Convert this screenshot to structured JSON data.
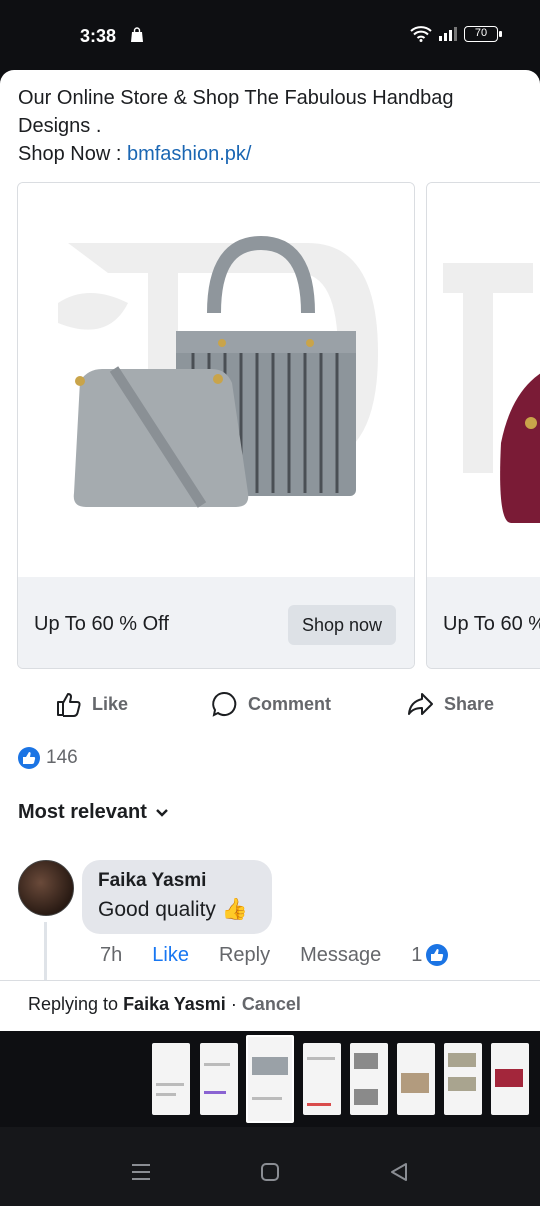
{
  "status": {
    "time": "3:38",
    "battery": "70"
  },
  "post": {
    "line1": "Our Online Store & Shop The Fabulous Handbag Designs .",
    "shop_prefix": "Shop Now : ",
    "link": "bmfashion.pk/"
  },
  "carousel": [
    {
      "title": "Up To 60 % Off",
      "button": "Shop now"
    },
    {
      "title": "Up To 60 %"
    }
  ],
  "actions": {
    "like": "Like",
    "comment": "Comment",
    "share": "Share"
  },
  "reactions": {
    "count": "146"
  },
  "filter": {
    "label": "Most relevant"
  },
  "comment": {
    "author": "Faika Yasmi",
    "text": "Good quality",
    "emoji": "👍",
    "time": "7h",
    "like": "Like",
    "reply": "Reply",
    "message": "Message",
    "likes": "1"
  },
  "reply_bar": {
    "prefix": "Replying to ",
    "name": "Faika Yasmi",
    "sep": " · ",
    "cancel": "Cancel"
  },
  "colors": {
    "accent": "#1877f2",
    "text": "#1c1e21",
    "muted": "#65676b"
  }
}
